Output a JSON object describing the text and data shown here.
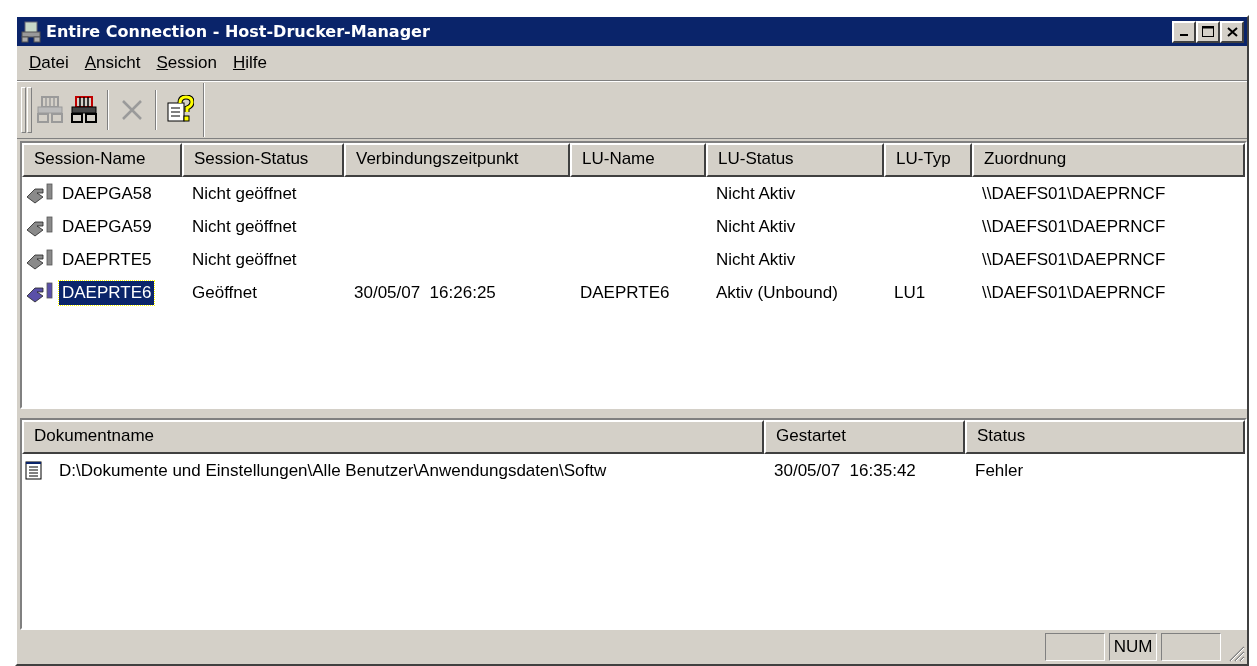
{
  "window": {
    "title": "Entire Connection - Host-Drucker-Manager"
  },
  "menu": [
    "Datei",
    "Ansicht",
    "Session",
    "Hilfe"
  ],
  "toolbar": [
    {
      "kind": "connect",
      "disabled": true
    },
    {
      "kind": "disconnect",
      "disabled": false
    },
    {
      "kind": "delete",
      "disabled": true
    },
    {
      "kind": "help",
      "disabled": false
    }
  ],
  "sessions": {
    "columns": [
      "Session-Name",
      "Session-Status",
      "Verbindungszeitpunkt",
      "LU-Name",
      "LU-Status",
      "LU-Typ",
      "Zuordnung"
    ],
    "rows": [
      {
        "session_name": "DAEPGA58",
        "session_status": "Nicht geöffnet",
        "lu_status": "Nicht Aktiv",
        "zuordnung": "\\\\DAEFS01\\DAEPRNCF",
        "active": false,
        "selected": false
      },
      {
        "session_name": "DAEPGA59",
        "session_status": "Nicht geöffnet",
        "lu_status": "Nicht Aktiv",
        "zuordnung": "\\\\DAEFS01\\DAEPRNCF",
        "active": false,
        "selected": false
      },
      {
        "session_name": "DAEPRTE5",
        "session_status": "Nicht geöffnet",
        "lu_status": "Nicht Aktiv",
        "zuordnung": "\\\\DAEFS01\\DAEPRNCF",
        "active": false,
        "selected": false
      },
      {
        "session_name": "DAEPRTE6",
        "session_status": "Geöffnet",
        "verbindungszeitpunkt": "30/05/07  16:26:25",
        "lu_name": "DAEPRTE6",
        "lu_status": "Aktiv (Unbound)",
        "lu_typ": "LU1",
        "zuordnung": "\\\\DAEFS01\\DAEPRNCF",
        "active": true,
        "selected": true
      }
    ]
  },
  "documents": {
    "columns": [
      "Dokumentname",
      "Gestartet",
      "Status"
    ],
    "rows": [
      {
        "dokumentname": "D:\\Dokumente und Einstellungen\\Alle Benutzer\\Anwendungsdaten\\Softw",
        "gestartet": "30/05/07  16:35:42",
        "status": "Fehler",
        "selected": false
      }
    ]
  },
  "status_bar": {
    "num_indicator": "NUM"
  }
}
